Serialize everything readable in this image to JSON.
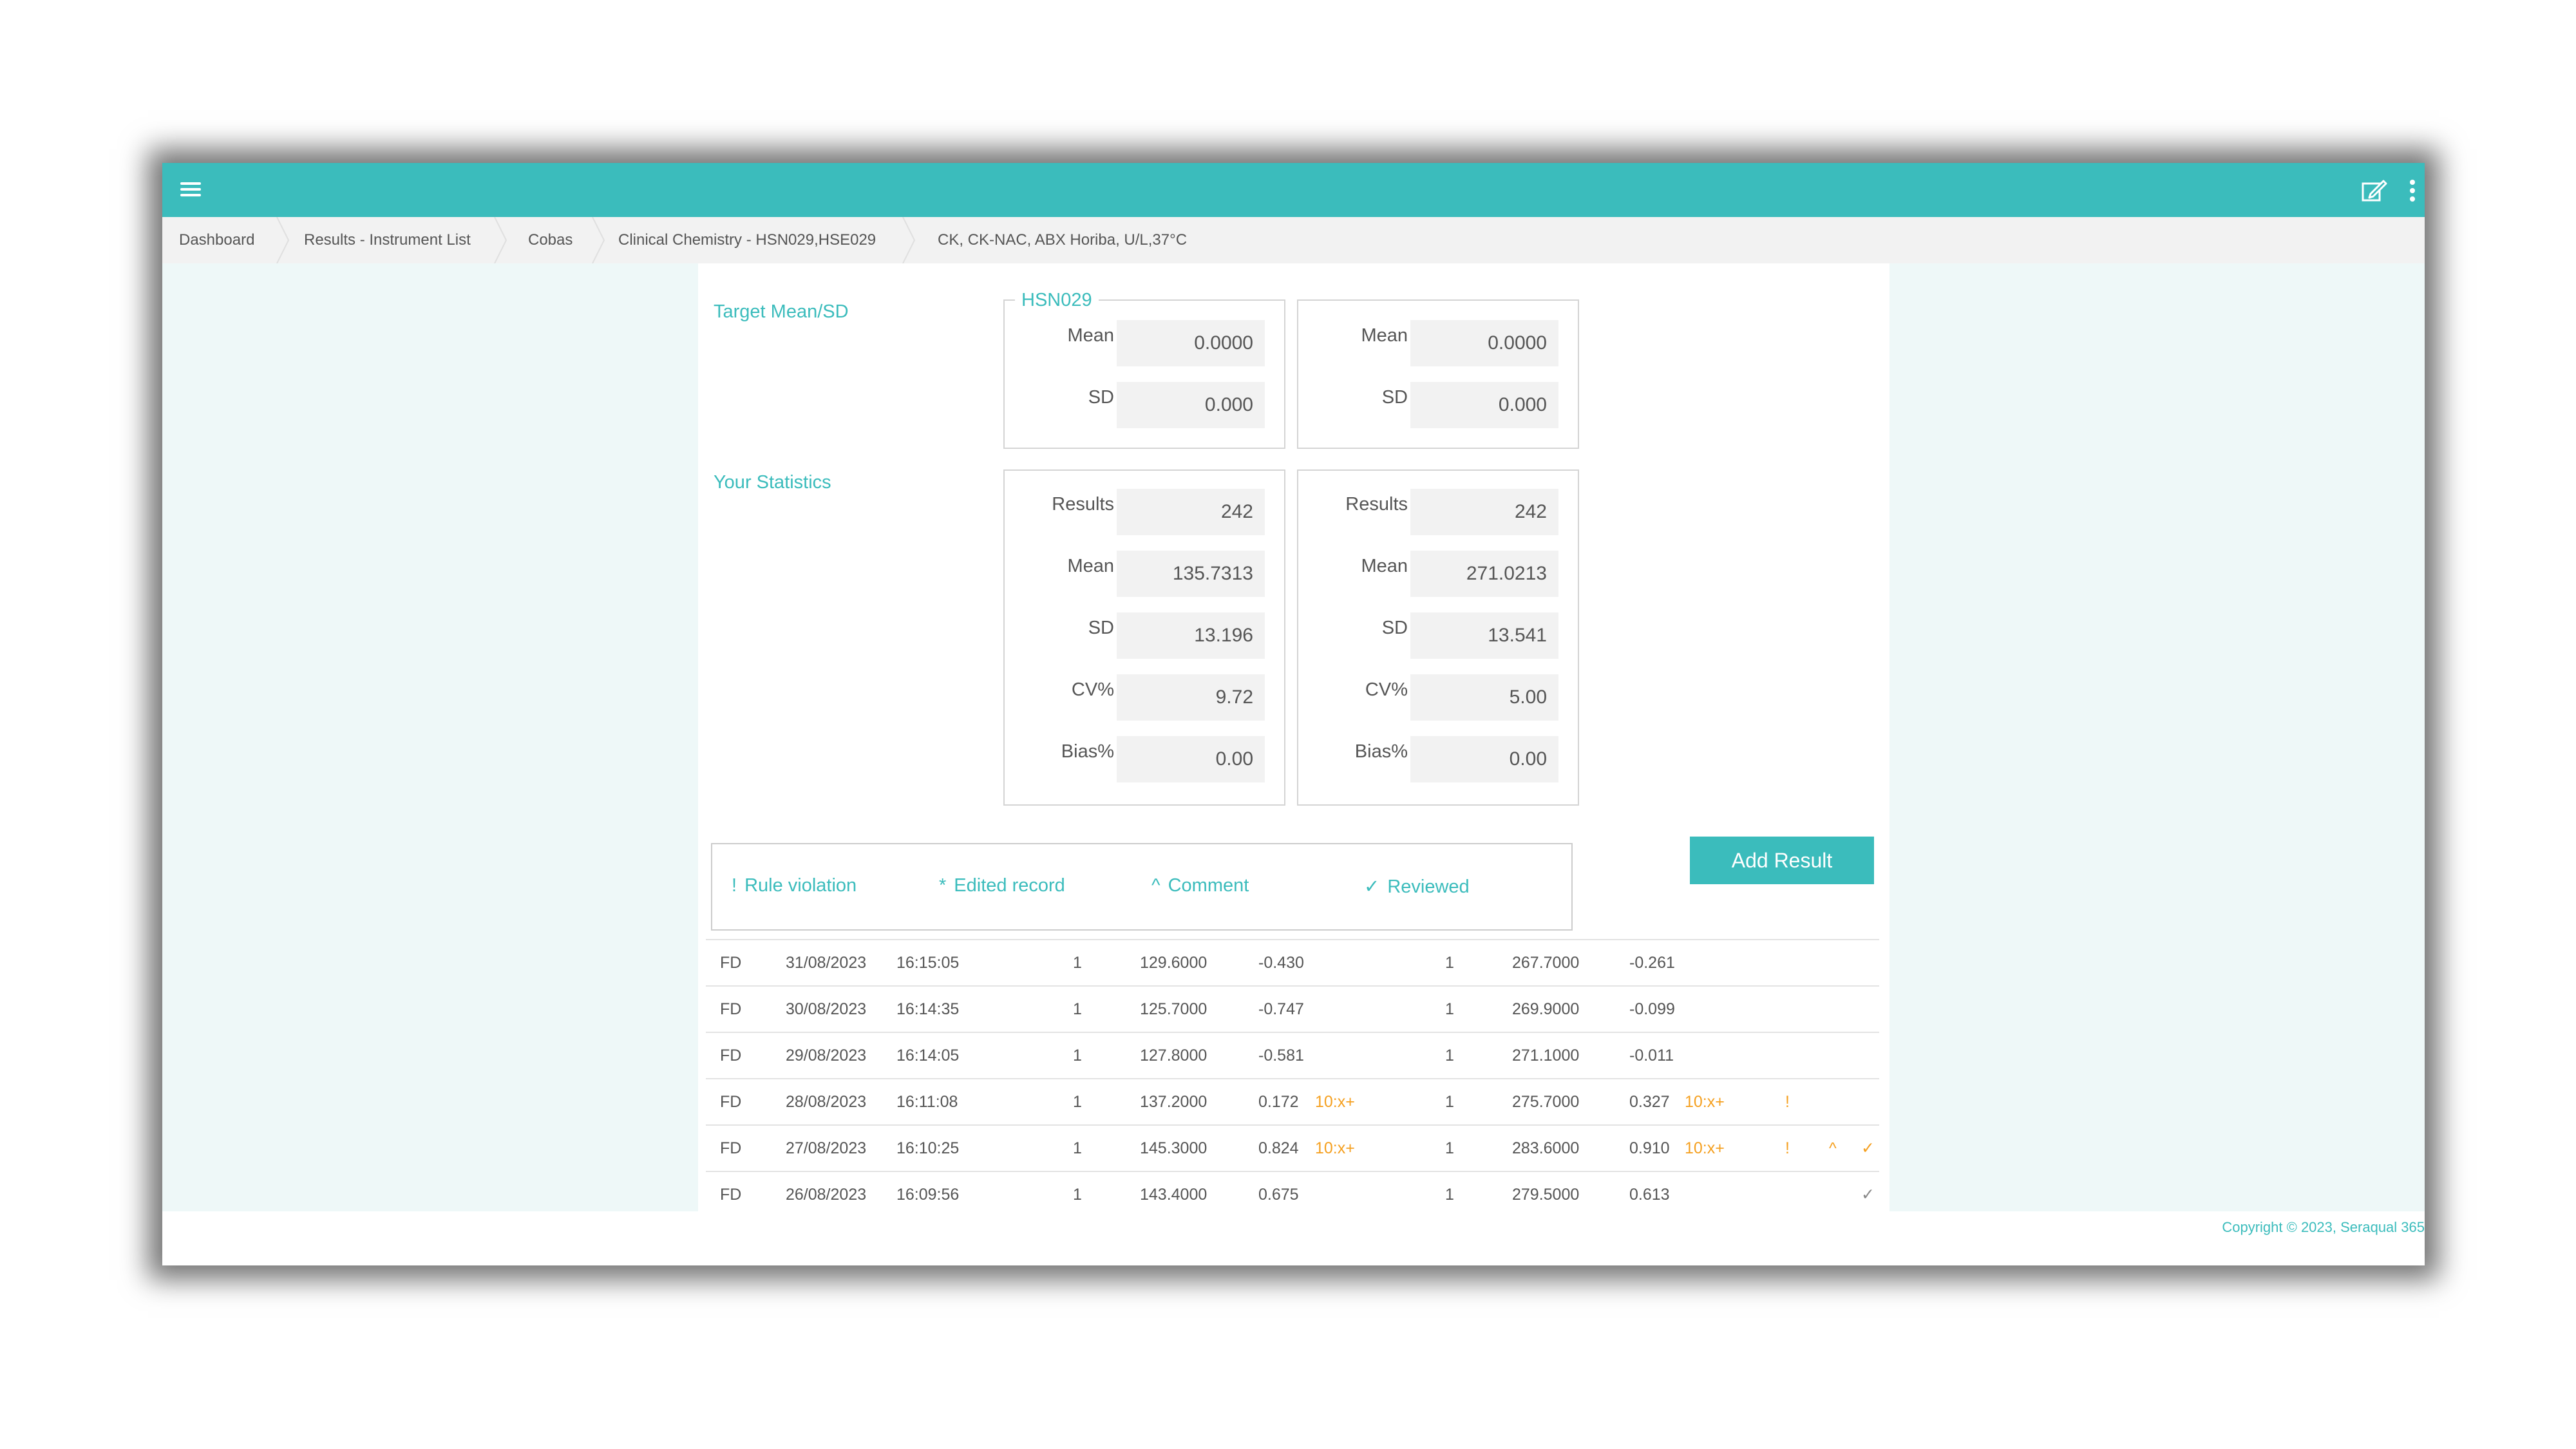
{
  "breadcrumb": [
    {
      "label": "Dashboard"
    },
    {
      "label": "Results - Instrument List"
    },
    {
      "label": "Cobas"
    },
    {
      "label": "Clinical Chemistry - HSN029,HSE029"
    },
    {
      "label": "CK, CK-NAC, ABX Horiba, U/L,37°C"
    }
  ],
  "target": {
    "section_label": "Target Mean/SD",
    "legend": "HSN029",
    "left": {
      "mean_label": "Mean",
      "mean": "0.0000",
      "sd_label": "SD",
      "sd": "0.000"
    },
    "right": {
      "mean_label": "Mean",
      "mean": "0.0000",
      "sd_label": "SD",
      "sd": "0.000"
    }
  },
  "stats": {
    "section_label": "Your Statistics",
    "labels": {
      "results": "Results",
      "mean": "Mean",
      "sd": "SD",
      "cv": "CV%",
      "bias": "Bias%"
    },
    "left": {
      "results": "242",
      "mean": "135.7313",
      "sd": "13.196",
      "cv": "9.72",
      "bias": "0.00"
    },
    "right": {
      "results": "242",
      "mean": "271.0213",
      "sd": "13.541",
      "cv": "5.00",
      "bias": "0.00"
    }
  },
  "legend_items": {
    "rule_symbol": "!",
    "rule_label": "Rule violation",
    "edited_symbol": "*",
    "edited_label": "Edited record",
    "comment_symbol": "^",
    "comment_label": "Comment",
    "reviewed_symbol": "✓",
    "reviewed_label": "Reviewed"
  },
  "add_result_label": "Add Result",
  "rows": [
    {
      "user": "FD",
      "date": "31/08/2023",
      "time": "16:15:05",
      "n1": "1",
      "v1": "129.6000",
      "z1": "-0.430",
      "r1": "",
      "n2": "1",
      "v2": "267.7000",
      "z2": "-0.261",
      "r2": "",
      "flag": "",
      "comment": "",
      "reviewed": ""
    },
    {
      "user": "FD",
      "date": "30/08/2023",
      "time": "16:14:35",
      "n1": "1",
      "v1": "125.7000",
      "z1": "-0.747",
      "r1": "",
      "n2": "1",
      "v2": "269.9000",
      "z2": "-0.099",
      "r2": "",
      "flag": "",
      "comment": "",
      "reviewed": ""
    },
    {
      "user": "FD",
      "date": "29/08/2023",
      "time": "16:14:05",
      "n1": "1",
      "v1": "127.8000",
      "z1": "-0.581",
      "r1": "",
      "n2": "1",
      "v2": "271.1000",
      "z2": "-0.011",
      "r2": "",
      "flag": "",
      "comment": "",
      "reviewed": ""
    },
    {
      "user": "FD",
      "date": "28/08/2023",
      "time": "16:11:08",
      "n1": "1",
      "v1": "137.2000",
      "z1": "0.172",
      "r1": "10:x+",
      "n2": "1",
      "v2": "275.7000",
      "z2": "0.327",
      "r2": "10:x+",
      "flag": "!",
      "comment": "",
      "reviewed": ""
    },
    {
      "user": "FD",
      "date": "27/08/2023",
      "time": "16:10:25",
      "n1": "1",
      "v1": "145.3000",
      "z1": "0.824",
      "r1": "10:x+",
      "n2": "1",
      "v2": "283.6000",
      "z2": "0.910",
      "r2": "10:x+",
      "flag": "!",
      "comment": "^",
      "reviewed": "✓"
    },
    {
      "user": "FD",
      "date": "26/08/2023",
      "time": "16:09:56",
      "n1": "1",
      "v1": "143.4000",
      "z1": "0.675",
      "r1": "",
      "n2": "1",
      "v2": "279.5000",
      "z2": "0.613",
      "r2": "",
      "flag": "",
      "comment": "",
      "reviewed": "✓"
    }
  ],
  "footer": {
    "copyright": "Copyright © 2023, Seraqual 365"
  },
  "colors": {
    "accent": "#3bbcbc",
    "warning": "#f5a020",
    "side_panel": "#eef8f8"
  },
  "icons": {
    "menu": "hamburger-menu-icon",
    "edit": "edit-icon",
    "more": "more-vertical-icon"
  }
}
